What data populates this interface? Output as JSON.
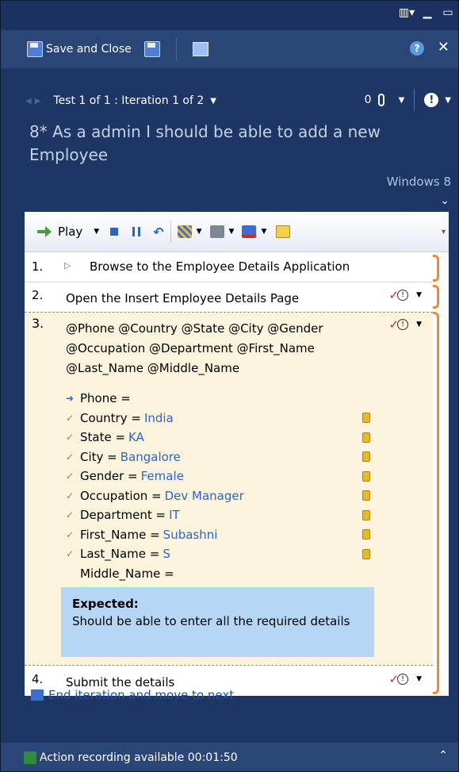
{
  "toolbar": {
    "save_close_label": "Save and Close"
  },
  "nav": {
    "test_label": "Test 1 of 1 : Iteration 1 of 2",
    "attachments_count": "0"
  },
  "test": {
    "title": "8* As a admin I should be able to add a new Employee",
    "configuration": "Windows 8"
  },
  "step_toolbar": {
    "play_label": "Play"
  },
  "steps": [
    {
      "num": "1.",
      "text": "Browse to the Employee Details Application"
    },
    {
      "num": "2.",
      "text": "Open the Insert Employee Details Page"
    },
    {
      "num": "3.",
      "params_line": "@Phone @Country @State @City @Gender @Occupation @Department @First_Name @Last_Name @Middle_Name"
    },
    {
      "num": "4.",
      "text": "Submit the details"
    }
  ],
  "parameters": [
    {
      "name": "Phone =",
      "value": "",
      "status": "current",
      "has_data_icon": false
    },
    {
      "name": "Country =",
      "value": "India",
      "status": "passed",
      "has_data_icon": true
    },
    {
      "name": "State =",
      "value": "KA",
      "status": "passed",
      "has_data_icon": true
    },
    {
      "name": "City =",
      "value": "Bangalore",
      "status": "passed",
      "has_data_icon": true
    },
    {
      "name": "Gender =",
      "value": "Female",
      "status": "passed",
      "has_data_icon": true
    },
    {
      "name": "Occupation =",
      "value": "Dev Manager",
      "status": "passed",
      "has_data_icon": true
    },
    {
      "name": "Department =",
      "value": "IT",
      "status": "passed",
      "has_data_icon": true
    },
    {
      "name": "First_Name =",
      "value": "Subashni",
      "status": "passed",
      "has_data_icon": true
    },
    {
      "name": "Last_Name =",
      "value": "S",
      "status": "passed",
      "has_data_icon": true
    },
    {
      "name": "Middle_Name =",
      "value": "",
      "status": "none",
      "has_data_icon": false
    }
  ],
  "expected": {
    "heading": "Expected:",
    "text": "Should be able to enter all the required details"
  },
  "end_iteration_label": "End iteration and move to next",
  "status": {
    "text": "Action recording available 00:01:50"
  },
  "colors": {
    "window_bg": "#1d3663",
    "toolbar_bg": "#2a4676",
    "active_step_bg": "#fdf4dd",
    "expected_bg": "#b6d6f5",
    "progress_bar": "#f08a32",
    "link": "#1f4fb5"
  }
}
